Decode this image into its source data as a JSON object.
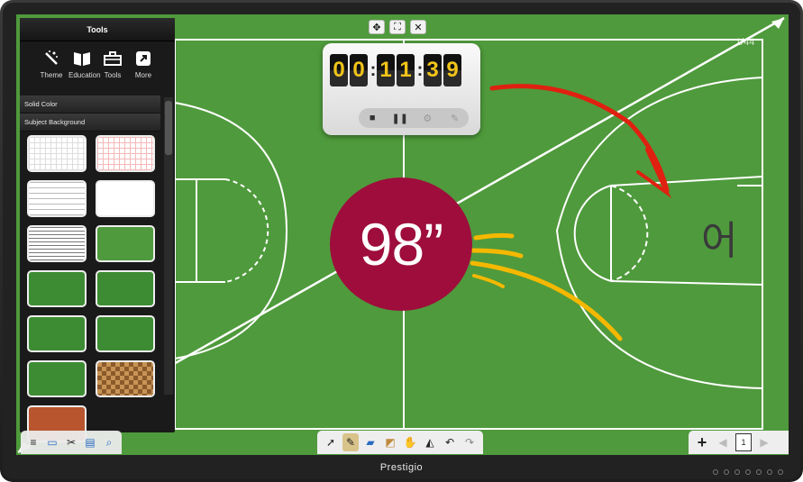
{
  "device": {
    "brand": "Prestigio"
  },
  "tools_panel": {
    "title": "Tools",
    "tabs": [
      {
        "label": "Theme",
        "icon": "theme-wand-icon"
      },
      {
        "label": "Education",
        "icon": "book-icon"
      },
      {
        "label": "Tools",
        "icon": "toolbox-icon"
      },
      {
        "label": "More",
        "icon": "more-arrow-icon"
      }
    ],
    "menu": [
      {
        "label": "Solid Color"
      },
      {
        "label": "Subject Background"
      }
    ]
  },
  "timer": {
    "digits": [
      "0",
      "0",
      "1",
      "1",
      "3",
      "9"
    ]
  },
  "badge": {
    "text": "98”"
  },
  "handwriting": {
    "text": "어"
  },
  "page_indicator": {
    "text": "1/44"
  },
  "bottom_right": {
    "page_number": "1"
  },
  "colors": {
    "field": "#4f9a3c",
    "badge": "#9e0d3c",
    "annotation_red": "#e02010",
    "annotation_yellow": "#f5b800"
  }
}
